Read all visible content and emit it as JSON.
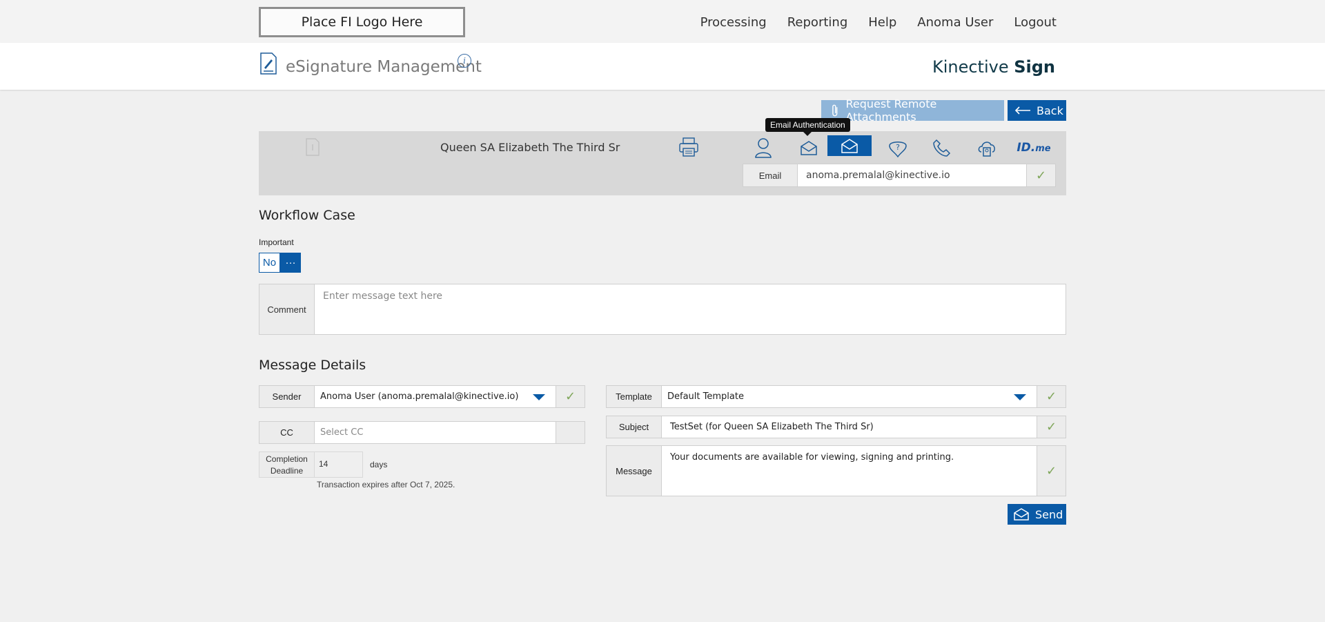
{
  "header": {
    "logo_placeholder": "Place FI Logo Here",
    "nav": [
      "Processing",
      "Reporting",
      "Help",
      "Anoma User",
      "Logout"
    ]
  },
  "title_bar": {
    "page_title": "eSignature Management",
    "info_icon": "info-icon",
    "brand_light": "Kinective ",
    "brand_bold": "Sign"
  },
  "actions": {
    "request_attachments": "Request Remote Attachments",
    "back": "Back"
  },
  "recipient": {
    "name": "Queen SA Elizabeth The Third Sr",
    "auth_methods": [
      "person-icon",
      "email-icon",
      "email-selected-icon",
      "question-shield-icon",
      "phone-icon",
      "cloud-person-icon",
      "idme-icon"
    ],
    "idme_label": "ID.",
    "idme_suffix": "me",
    "tooltip": "Email Authentication",
    "email_label": "Email",
    "email_value": "anoma.premalal@kinective.io",
    "check": "✓"
  },
  "workflow": {
    "title": "Workflow Case",
    "important_label": "Important",
    "important_value": "No",
    "important_more": "···",
    "comment_label": "Comment",
    "comment_placeholder": "Enter message text here"
  },
  "message_details": {
    "title": "Message Details",
    "sender_label": "Sender",
    "sender_value": "Anoma User (anoma.premalal@kinective.io)",
    "cc_label": "CC",
    "cc_placeholder": "Select CC",
    "deadline_label": "Completion Deadline",
    "deadline_value": "14",
    "deadline_unit": "days",
    "expire_text": "Transaction expires after Oct 7, 2025.",
    "template_label": "Template",
    "template_value": "Default Template",
    "subject_label": "Subject",
    "subject_value": "TestSet (for Queen SA Elizabeth The Third Sr)",
    "message_label": "Message",
    "message_value": "Your documents are available for viewing, signing and printing.",
    "check": "✓",
    "send": "Send"
  },
  "colors": {
    "accent": "#0a5aa6",
    "accent_light": "#8fb5d9",
    "check": "#7fa65a"
  }
}
